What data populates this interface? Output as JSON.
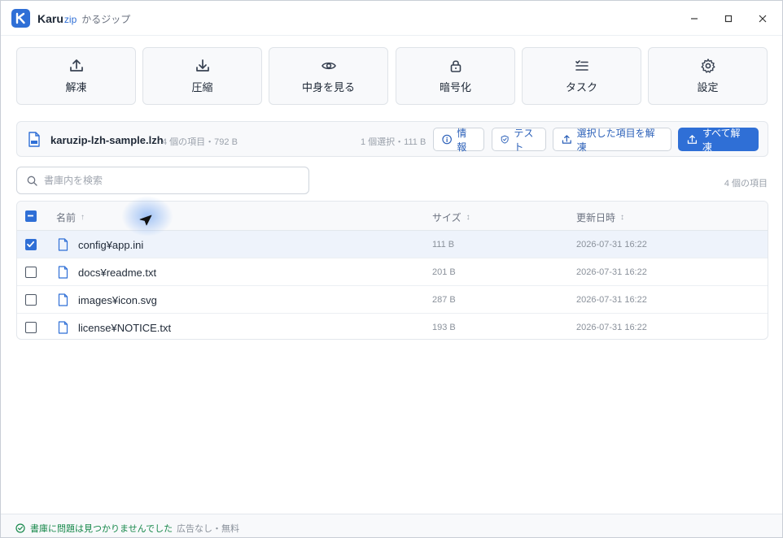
{
  "window": {
    "brand": "Karu",
    "brand_suffix": "zip",
    "subtitle": "かるジップ"
  },
  "toolbar": {
    "buttons": [
      {
        "label": "解凍",
        "icon": "upload-icon"
      },
      {
        "label": "圧縮",
        "icon": "download-icon"
      },
      {
        "label": "中身を見る",
        "icon": "eye-icon"
      },
      {
        "label": "暗号化",
        "icon": "lock-icon"
      },
      {
        "label": "タスク",
        "icon": "task-list-icon"
      },
      {
        "label": "設定",
        "icon": "gear-icon"
      }
    ]
  },
  "archive": {
    "name": "karuzip-lzh-sample.lzh",
    "meta": "4 個の項目・792 B",
    "selection": "1 個選択・111 B",
    "info_label": "情報",
    "test_label": "テスト",
    "extract_selected_label": "選択した項目を解凍",
    "extract_all_label": "すべて解凍"
  },
  "search": {
    "placeholder": "書庫内を検索",
    "value": ""
  },
  "item_count": "4 個の項目",
  "table": {
    "headers": {
      "name": "名前",
      "size": "サイズ",
      "date": "更新日時"
    },
    "sort_asc": "↑",
    "sort_both": "↕",
    "rows": [
      {
        "name": "config¥app.ini",
        "size": "111 B",
        "date": "2026-07-31 16:22",
        "selected": true
      },
      {
        "name": "docs¥readme.txt",
        "size": "201 B",
        "date": "2026-07-31 16:22",
        "selected": false
      },
      {
        "name": "images¥icon.svg",
        "size": "287 B",
        "date": "2026-07-31 16:22",
        "selected": false
      },
      {
        "name": "license¥NOTICE.txt",
        "size": "193 B",
        "date": "2026-07-31 16:22",
        "selected": false
      }
    ]
  },
  "status": {
    "ok_text": "書庫に問題は見つかりませんでした",
    "separator": "·",
    "free_text": "広告なし・無料"
  },
  "colors": {
    "accent": "#2f6fd6",
    "success": "#16884a"
  }
}
